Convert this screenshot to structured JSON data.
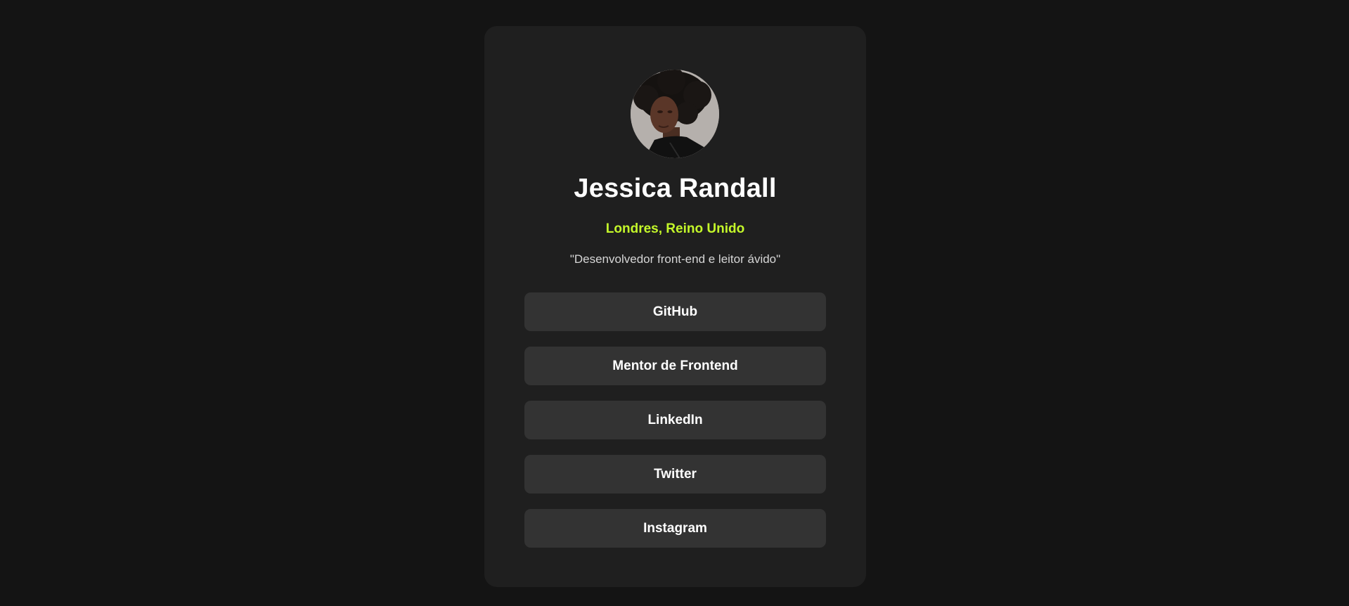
{
  "profile": {
    "avatar_alt": "Jessica Randall",
    "name": "Jessica Randall",
    "location": "Londres, Reino Unido",
    "bio": "\"Desenvolvedor front-end e leitor ávido\""
  },
  "links": [
    {
      "label": "GitHub"
    },
    {
      "label": "Mentor de Frontend"
    },
    {
      "label": "LinkedIn"
    },
    {
      "label": "Twitter"
    },
    {
      "label": "Instagram"
    }
  ],
  "colors": {
    "background": "#141414",
    "card": "#1f1f1f",
    "button": "#333333",
    "accent": "#c4f82a",
    "text": "#ffffff"
  }
}
